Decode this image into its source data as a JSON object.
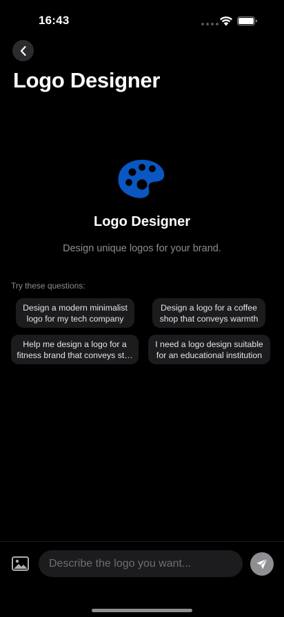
{
  "status_bar": {
    "time": "16:43"
  },
  "header": {
    "title": "Logo Designer"
  },
  "hero": {
    "icon": "palette-icon",
    "icon_color": "#0a57c2",
    "title": "Logo Designer",
    "subtitle": "Design unique logos for your brand."
  },
  "suggestions": {
    "label": "Try these questions:",
    "items": [
      {
        "text": "Design a modern minimalist logo for my tech company"
      },
      {
        "text": "Design a logo for a coffee shop that conveys warmth"
      },
      {
        "text": "Help me design a logo for a fitness brand that conveys st…"
      },
      {
        "text": "I need a logo design suitable for an educational institution"
      }
    ]
  },
  "composer": {
    "placeholder": "Describe the logo you want...",
    "image_icon": "image-icon",
    "send_icon": "send-icon"
  }
}
